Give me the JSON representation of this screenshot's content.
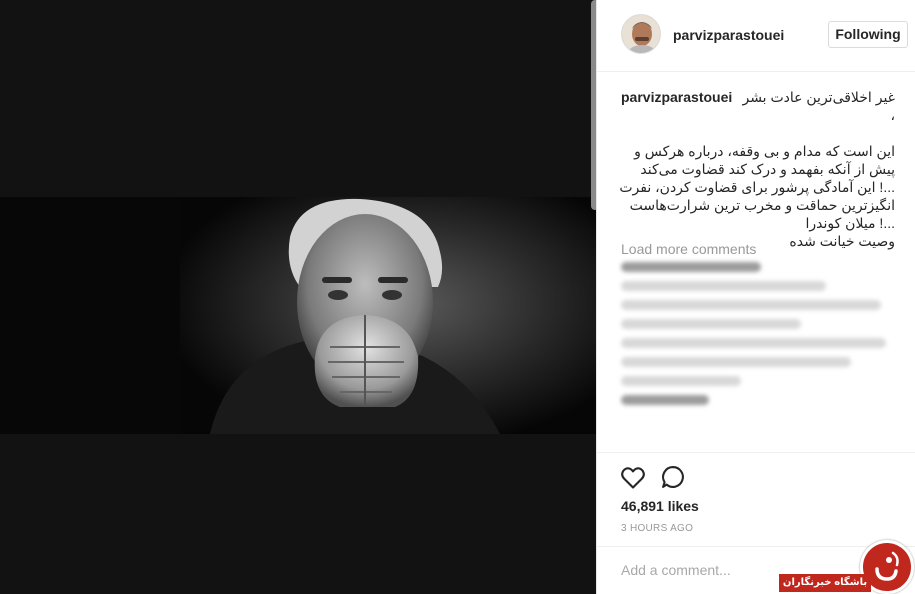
{
  "post": {
    "username": "parvizparastouei",
    "follow_label": "Following"
  },
  "caption": {
    "username": "parvizparastouei",
    "first_line": "غیر اخلاقی‌ترین عادت بشر ،",
    "lines": [
      "این است که مدام و بی وقفه، درباره هرکس و",
      "پیش از آنکه بفهمد و درک کند قضاوت می‌کند",
      "...! این آمادگی پرشور برای قضاوت کردن، نفرت",
      "انگیزترین حماقت و مخرب ترین شرارت‌هاست",
      "...! میلان کوندرا",
      "وصیت خیانت شده"
    ]
  },
  "comments": {
    "load_more_label": "Load more comments"
  },
  "actions": {
    "likes": "46,891 likes",
    "time": "3 HOURS AGO",
    "like_icon": "heart-icon",
    "comment_icon": "comment-icon"
  },
  "comment_box": {
    "placeholder": "Add a comment..."
  },
  "watermark": {
    "text": "باشگاه خبرنگاران"
  },
  "colors": {
    "panel_bg": "#ffffff",
    "media_bg": "#121212",
    "text": "#262626",
    "muted": "#999999",
    "watermark_red": "#c0271d"
  }
}
